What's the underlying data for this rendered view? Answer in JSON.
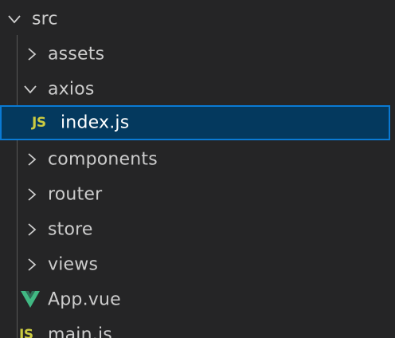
{
  "explorer": {
    "root": {
      "label": "src",
      "expanded": true
    },
    "items": [
      {
        "label": "assets",
        "type": "folder",
        "expanded": false
      },
      {
        "label": "axios",
        "type": "folder",
        "expanded": true
      },
      {
        "label": "index.js",
        "type": "file",
        "icon": "js-icon",
        "selected": true
      },
      {
        "label": "components",
        "type": "folder",
        "expanded": false
      },
      {
        "label": "router",
        "type": "folder",
        "expanded": false
      },
      {
        "label": "store",
        "type": "folder",
        "expanded": false
      },
      {
        "label": "views",
        "type": "folder",
        "expanded": false
      },
      {
        "label": "App.vue",
        "type": "file",
        "icon": "vue-icon"
      },
      {
        "label": "main.js",
        "type": "file",
        "icon": "js-icon"
      }
    ],
    "icon_labels": {
      "js": "JS"
    }
  },
  "colors": {
    "background": "#252526",
    "text": "#cccccc",
    "selection_bg": "#04395e",
    "selection_border": "#0a7ad4",
    "js_icon": "#cbcb41",
    "vue_icon": "#41b883"
  }
}
